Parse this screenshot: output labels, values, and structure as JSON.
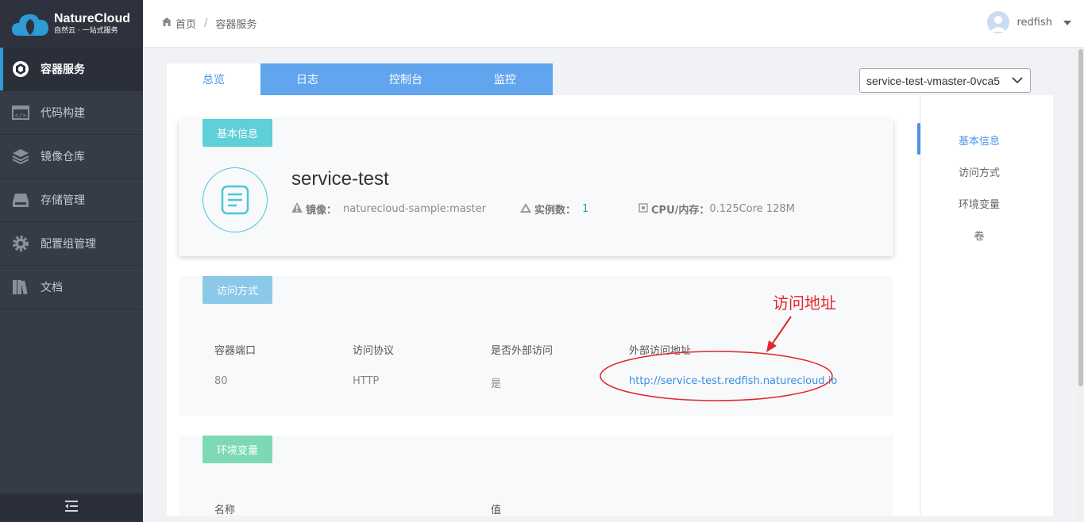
{
  "brand": {
    "name": "NatureCloud",
    "slogan": "自然云 · 一站式服务"
  },
  "sidebar": {
    "items": [
      {
        "label": "容器服务",
        "icon": "container-icon",
        "active": true
      },
      {
        "label": "代码构建",
        "icon": "code-icon",
        "active": false
      },
      {
        "label": "镜像仓库",
        "icon": "layers-icon",
        "active": false
      },
      {
        "label": "存储管理",
        "icon": "storage-icon",
        "active": false
      },
      {
        "label": "配置组管理",
        "icon": "gear-icon",
        "active": false
      },
      {
        "label": "文档",
        "icon": "books-icon",
        "active": false
      }
    ],
    "collapse_icon": "collapse-menu-icon"
  },
  "header": {
    "breadcrumb": {
      "home": "首页",
      "sep": "/",
      "current": "容器服务"
    },
    "user": {
      "name": "redfish"
    }
  },
  "tabs": [
    "总览",
    "日志",
    "控制台",
    "监控"
  ],
  "version_select": {
    "value": "service-test-vmaster-0vca5"
  },
  "basic_info": {
    "tag": "基本信息",
    "service_name": "service-test",
    "image_label": "镜像：",
    "image_value": "naturecloud-sample:master",
    "instances_label": "实例数：",
    "instances_value": "1",
    "cpu_label": "CPU/内存：",
    "cpu_value": "0.125Core 128M"
  },
  "access": {
    "tag": "访问方式",
    "headers": [
      "容器端口",
      "访问协议",
      "是否外部访问",
      "外部访问地址"
    ],
    "row": [
      "80",
      "HTTP",
      "是",
      "http://service-test.redfish.naturecloud.io"
    ]
  },
  "env": {
    "tag": "环境变量",
    "headers": [
      "名称",
      "值"
    ]
  },
  "anchors": [
    "基本信息",
    "访问方式",
    "环境变量",
    "卷"
  ],
  "annotation": {
    "text": "访问地址",
    "color": "#e3262b"
  },
  "colors": {
    "accent": "#4a94e8",
    "tab_bg": "#61a5ee",
    "tag_basic": "#5fcfd9",
    "tag_access": "#8cc8e8",
    "tag_env": "#7dd8b4",
    "instances": "#2aa58c"
  }
}
